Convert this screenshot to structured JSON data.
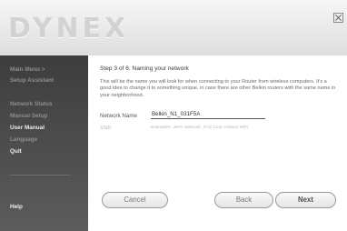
{
  "header": {
    "logo_text": "DYNEX",
    "close_label": "close"
  },
  "sidebar": {
    "items": [
      {
        "label": "Main Menu  >"
      },
      {
        "label": "Setup Assistant"
      },
      {
        "label": "Network Status"
      },
      {
        "label": "Manual Setup"
      },
      {
        "label": "User Manual"
      },
      {
        "label": "Language"
      },
      {
        "label": "Quit"
      },
      {
        "label": "Help"
      }
    ]
  },
  "content": {
    "step_title": "Step 3 of 6: Naming your network",
    "description": "This will be the name you will look for when connecting to your Router from wireless computers. It's a good idea to change it to something unique, in case there are other Belkin routers with the same name in your neighborhood.",
    "network_name_label": "Network Name",
    "network_name_value": "Belkin_N1_031F5A",
    "ssid_label": "SSID",
    "ssid_example": "Examples: Jen's Network, XYZ Corp Visitors WiFi"
  },
  "buttons": {
    "cancel": "Cancel",
    "back": "Back",
    "next": "Next"
  },
  "colors": {
    "sidebar_bg": "#4a4a4a",
    "header_bg": "#e6e6e6",
    "logo": "#d2d2d2"
  },
  "icons": {
    "close": "close-icon"
  }
}
